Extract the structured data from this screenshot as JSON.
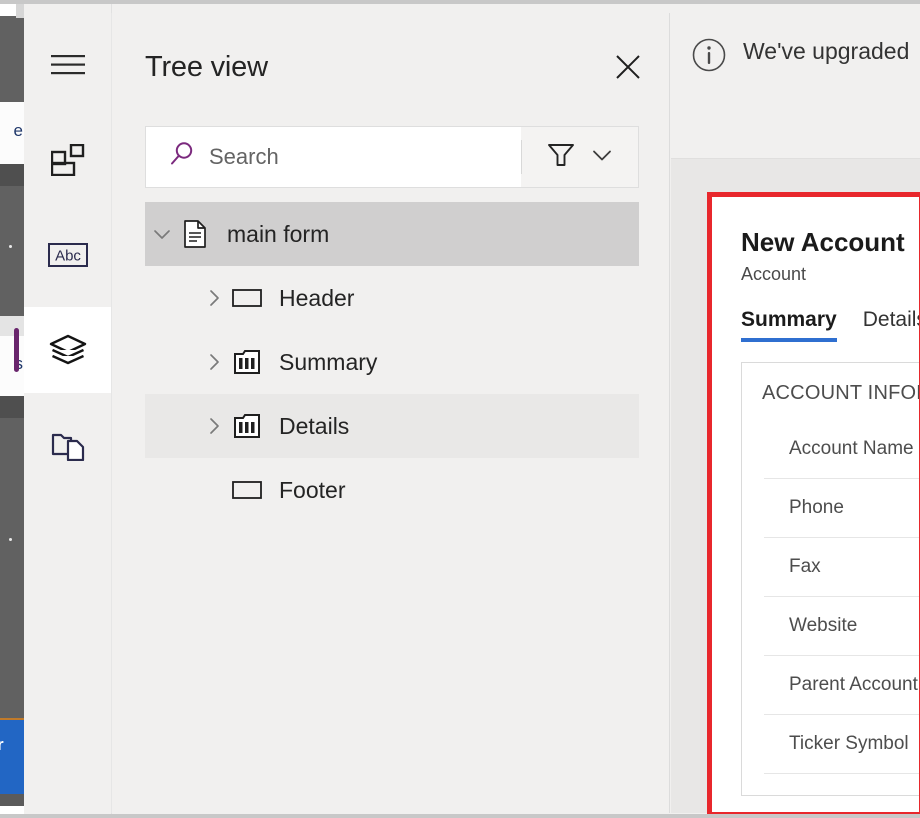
{
  "rail": {
    "items": [
      {
        "name": "menu",
        "icon": "hamburger-menu-icon",
        "selected": false
      },
      {
        "name": "components",
        "icon": "components-grid-icon",
        "selected": false
      },
      {
        "name": "text",
        "icon": "abc-text-icon",
        "label": "Abc",
        "selected": false
      },
      {
        "name": "tree-view",
        "icon": "layers-icon",
        "selected": true
      },
      {
        "name": "pages",
        "icon": "folder-page-icon",
        "selected": false
      }
    ]
  },
  "tree_panel": {
    "title": "Tree view",
    "close_icon": "close-icon",
    "search": {
      "placeholder": "Search",
      "value": "",
      "icon": "search-icon",
      "filter_icon": "filter-funnel-icon",
      "chevron_icon": "chevron-down-icon"
    },
    "items": [
      {
        "label": "main form",
        "icon": "form-document-icon",
        "level": 1,
        "state": "selected",
        "expanded": true,
        "has_chevron": true
      },
      {
        "label": "Header",
        "icon": "section-rectangle-icon",
        "level": 2,
        "state": "normal",
        "expanded": false,
        "has_chevron": true
      },
      {
        "label": "Summary",
        "icon": "columns-tab-icon",
        "level": 2,
        "state": "normal",
        "expanded": false,
        "has_chevron": true
      },
      {
        "label": "Details",
        "icon": "columns-tab-icon",
        "level": 2,
        "state": "hovered",
        "expanded": false,
        "has_chevron": true
      },
      {
        "label": "Footer",
        "icon": "section-rectangle-icon",
        "level": 2,
        "state": "normal",
        "expanded": false,
        "has_chevron": false
      }
    ]
  },
  "notification": {
    "icon": "info-circle-icon",
    "text": "We've upgraded"
  },
  "form_preview": {
    "title": "New Account",
    "subtitle": "Account",
    "tabs": [
      {
        "label": "Summary",
        "active": true
      },
      {
        "label": "Details",
        "active": false
      }
    ],
    "section_heading": "ACCOUNT INFOR",
    "fields": [
      "Account Name",
      "Phone",
      "Fax",
      "Website",
      "Parent Account",
      "Ticker Symbol"
    ]
  },
  "colors": {
    "accent_purple": "#69256c",
    "highlight_red": "#e8272c",
    "tab_underline_blue": "#2f6fd0",
    "panel_bg": "#f1f0ef",
    "selected_row": "#d0cfcf",
    "hovered_row": "#e9e8e7"
  }
}
